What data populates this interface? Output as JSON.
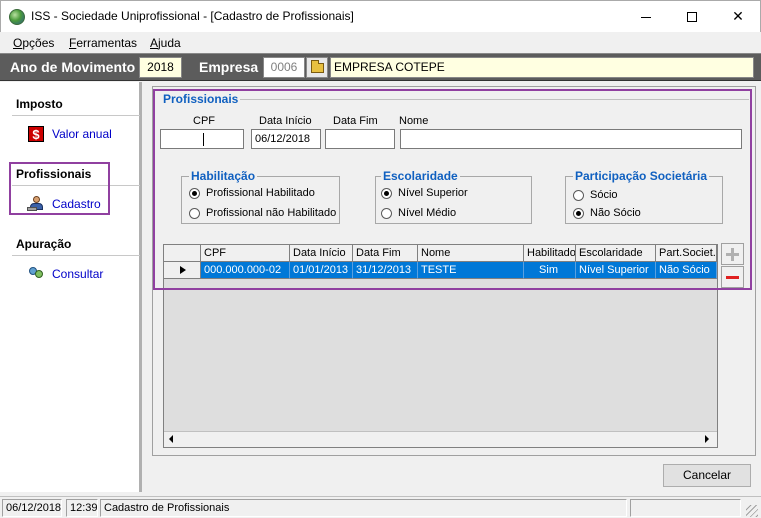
{
  "window": {
    "title": "ISS - Sociedade Uniprofissional - [Cadastro de Profissionais]",
    "minimize_label": "",
    "maximize_label": "",
    "close_label": "✕"
  },
  "menu": {
    "items": [
      {
        "label": "Opções"
      },
      {
        "label": "Ferramentas"
      },
      {
        "label": "Ajuda"
      }
    ]
  },
  "toolbar": {
    "year_label": "Ano de Movimento",
    "year_value": "2018",
    "company_label": "Empresa",
    "company_code": "0006",
    "company_name": "EMPRESA COTEPE"
  },
  "nav": {
    "sections": [
      {
        "title": "Imposto",
        "link": "Valor anual",
        "icon": "dollar-icon"
      },
      {
        "title": "Profissionais",
        "link": "Cadastro",
        "icon": "person-at-desk-icon"
      },
      {
        "title": "Apuração",
        "link": "Consultar",
        "icon": "search-people-icon"
      }
    ]
  },
  "form": {
    "group_title": "Profissionais",
    "fields": {
      "cpf_label": "CPF",
      "cpf_value": "",
      "data_inicio_label": "Data Início",
      "data_inicio_value": "06/12/2018",
      "data_fim_label": "Data Fim",
      "data_fim_value": "",
      "nome_label": "Nome",
      "nome_value": ""
    },
    "habilitacao": {
      "title": "Habilitação",
      "options": [
        "Profissional Habilitado",
        "Profissional não Habilitado"
      ],
      "selected": "Profissional Habilitado"
    },
    "escolaridade": {
      "title": "Escolaridade",
      "options": [
        "Nível Superior",
        "Nível Médio"
      ],
      "selected": "Nível Superior"
    },
    "participacao": {
      "title": "Participação Societária",
      "options": [
        "Sócio",
        "Não Sócio"
      ],
      "selected": "Não Sócio"
    }
  },
  "grid": {
    "columns": [
      "CPF",
      "Data Início",
      "Data Fim",
      "Nome",
      "Habilitado",
      "Escolaridade",
      "Part.Societ."
    ],
    "rows": [
      [
        "000.000.000-02",
        "01/01/2013",
        "31/12/2013",
        "TESTE",
        "Sim",
        "Nível Superior",
        "Não Sócio"
      ]
    ]
  },
  "buttons": {
    "cancel": "Cancelar"
  },
  "status": {
    "date": "06/12/2018",
    "time": "12:39",
    "screen": "Cadastro de Profissionais"
  },
  "colors": {
    "accent_legend": "#1060c0",
    "selection": "#0078d7",
    "highlight_box": "#9040a0",
    "toolbar_strip": "#5c5c5c",
    "info_field": "#ffffe1"
  }
}
